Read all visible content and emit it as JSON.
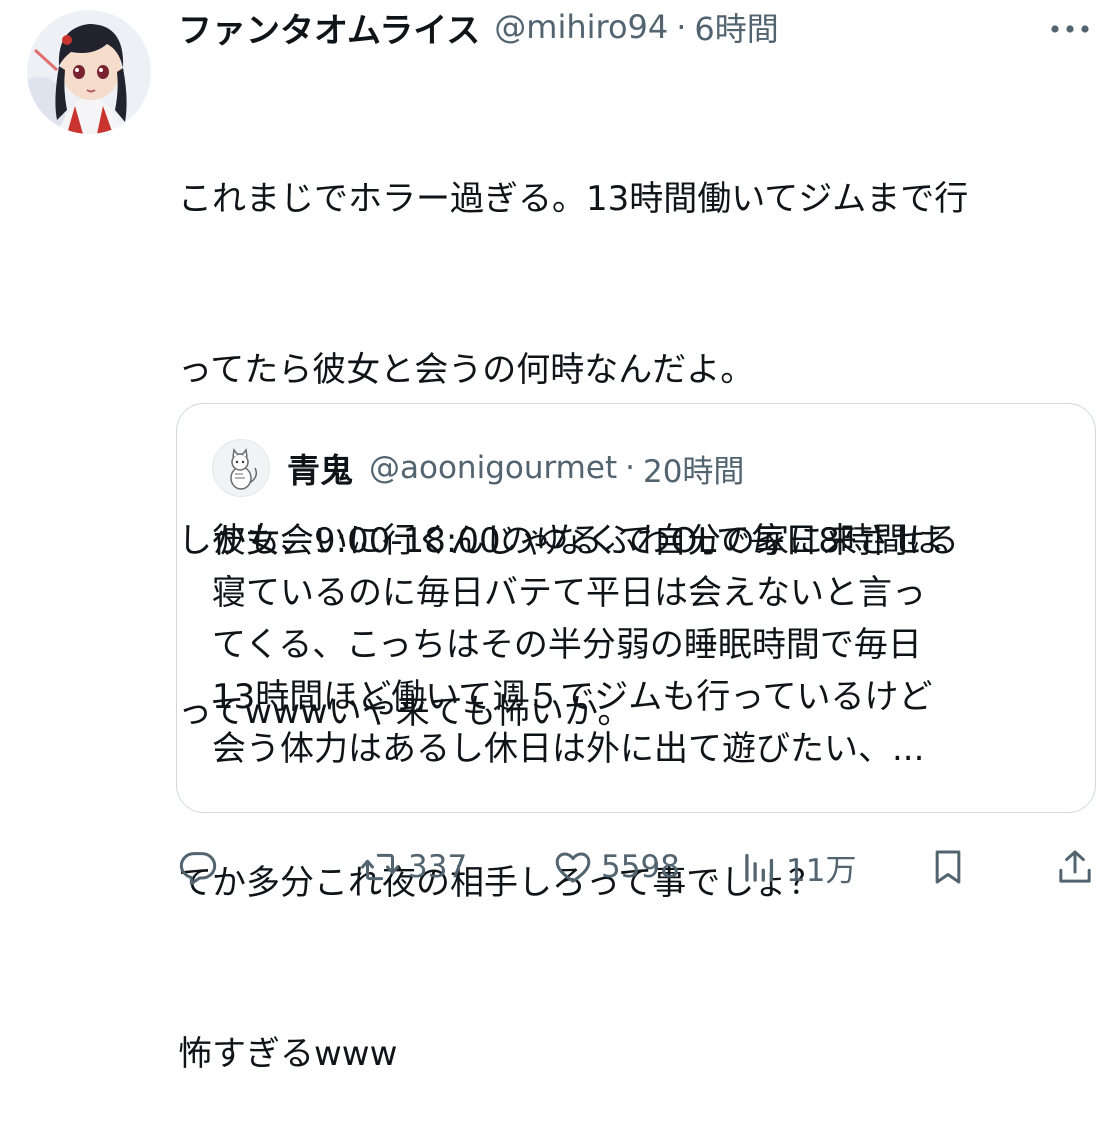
{
  "tweet": {
    "author_name": "ファンタオムライス",
    "handle": "@mihiro94",
    "separator": "·",
    "time": "6時間",
    "text_lines": [
      "これまじでホラー過ぎる。13時間働いてジムまで行",
      "ってたら彼女と会うの何時なんだよ。",
      "しかも会いに行くんじゃなくて自分の家に来させる",
      "ってwwwいや来ても怖いか。",
      "てか多分これ夜の相手しろって事でしょ？",
      "怖すぎるwww"
    ]
  },
  "quote": {
    "author_name": "青鬼",
    "handle": "@aoonigourmet",
    "separator": "·",
    "time": "20時間",
    "text_lines": [
      "彼女、9:00-18:00のゆるふわOLで毎日8時間は",
      "寝ているのに毎日バテて平日は会えないと言っ",
      "てくる、こっちはその半分弱の睡眠時間で毎日",
      "13時間ほど働いて週５でジムも行っているけど",
      "会う体力はあるし休日は外に出て遊びたい、..."
    ]
  },
  "actions": {
    "reply": {
      "icon": "reply-icon",
      "count": ""
    },
    "retweet": {
      "icon": "retweet-icon",
      "count": "337"
    },
    "like": {
      "icon": "heart-icon",
      "count": "5598"
    },
    "views": {
      "icon": "views-icon",
      "count": "11万"
    },
    "bookmark": {
      "icon": "bookmark-icon",
      "count": ""
    },
    "share": {
      "icon": "share-icon",
      "count": ""
    }
  },
  "colors": {
    "text": "#0f1419",
    "secondary": "#536471",
    "border": "#cfd9de"
  }
}
